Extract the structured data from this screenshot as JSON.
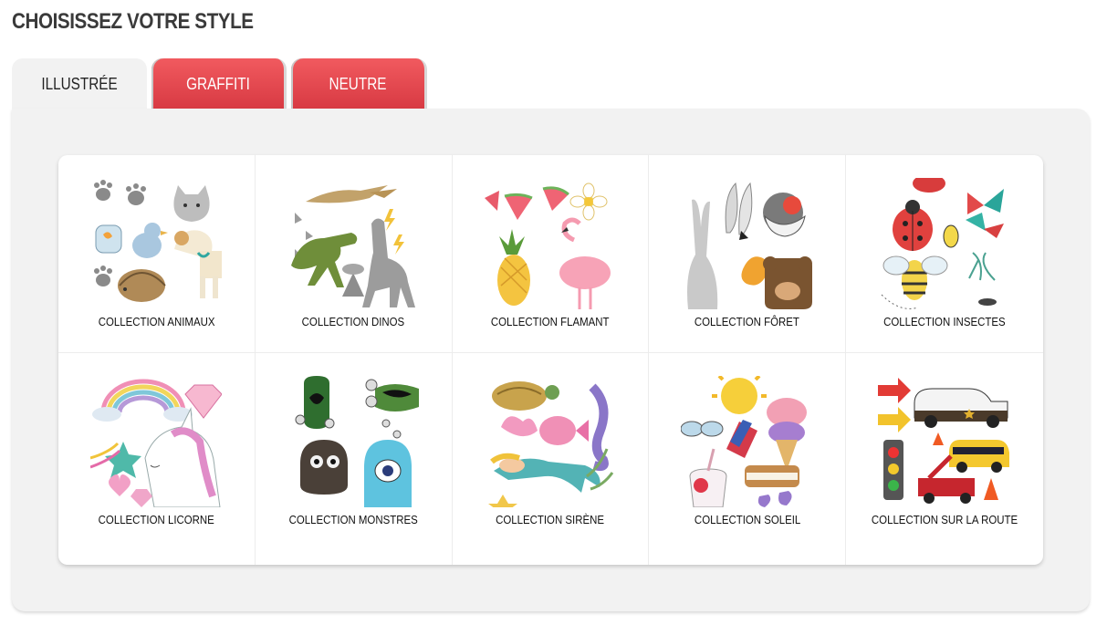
{
  "page": {
    "title": "CHOISISSEZ VOTRE STYLE"
  },
  "tabs": [
    {
      "label": "ILLUSTRÉE",
      "active": true
    },
    {
      "label": "GRAFFITI",
      "active": false
    },
    {
      "label": "NEUTRE",
      "active": false
    }
  ],
  "collections": [
    {
      "label": "COLLECTION ANIMAUX",
      "icon": "animals-collage-icon"
    },
    {
      "label": "COLLECTION DINOS",
      "icon": "dinosaurs-collage-icon"
    },
    {
      "label": "COLLECTION FLAMANT",
      "icon": "flamingo-collage-icon"
    },
    {
      "label": "COLLECTION FÔRET",
      "icon": "forest-collage-icon"
    },
    {
      "label": "COLLECTION INSECTES",
      "icon": "insects-collage-icon"
    },
    {
      "label": "COLLECTION LICORNE",
      "icon": "unicorn-collage-icon"
    },
    {
      "label": "COLLECTION MONSTRES",
      "icon": "monsters-collage-icon"
    },
    {
      "label": "COLLECTION SIRÈNE",
      "icon": "mermaid-collage-icon"
    },
    {
      "label": "COLLECTION SOLEIL",
      "icon": "summer-collage-icon"
    },
    {
      "label": "COLLECTION SUR LA ROUTE",
      "icon": "road-collage-icon"
    }
  ],
  "colors": {
    "tab_red": "#e2454c",
    "panel_bg": "#f2f2f2"
  }
}
